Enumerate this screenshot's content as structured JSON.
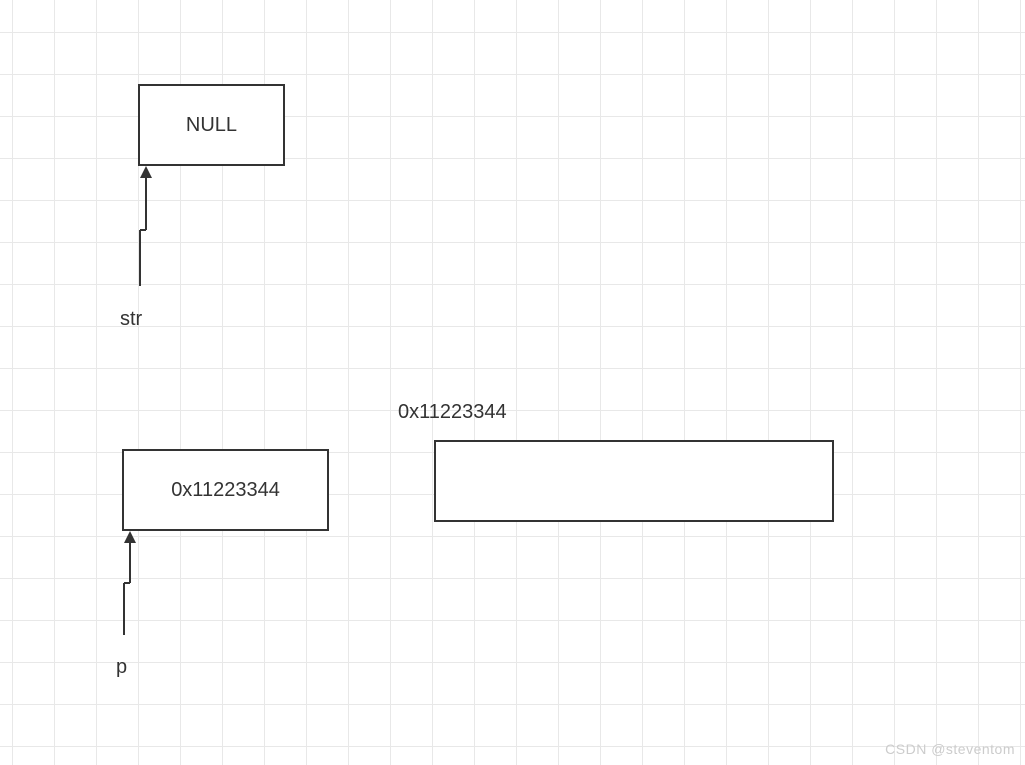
{
  "box_null": {
    "label": "NULL"
  },
  "box_pvalue": {
    "label": "0x11223344"
  },
  "str_label": "str",
  "p_label": "p",
  "address_label": "0x11223344",
  "watermark": "CSDN @steventom"
}
